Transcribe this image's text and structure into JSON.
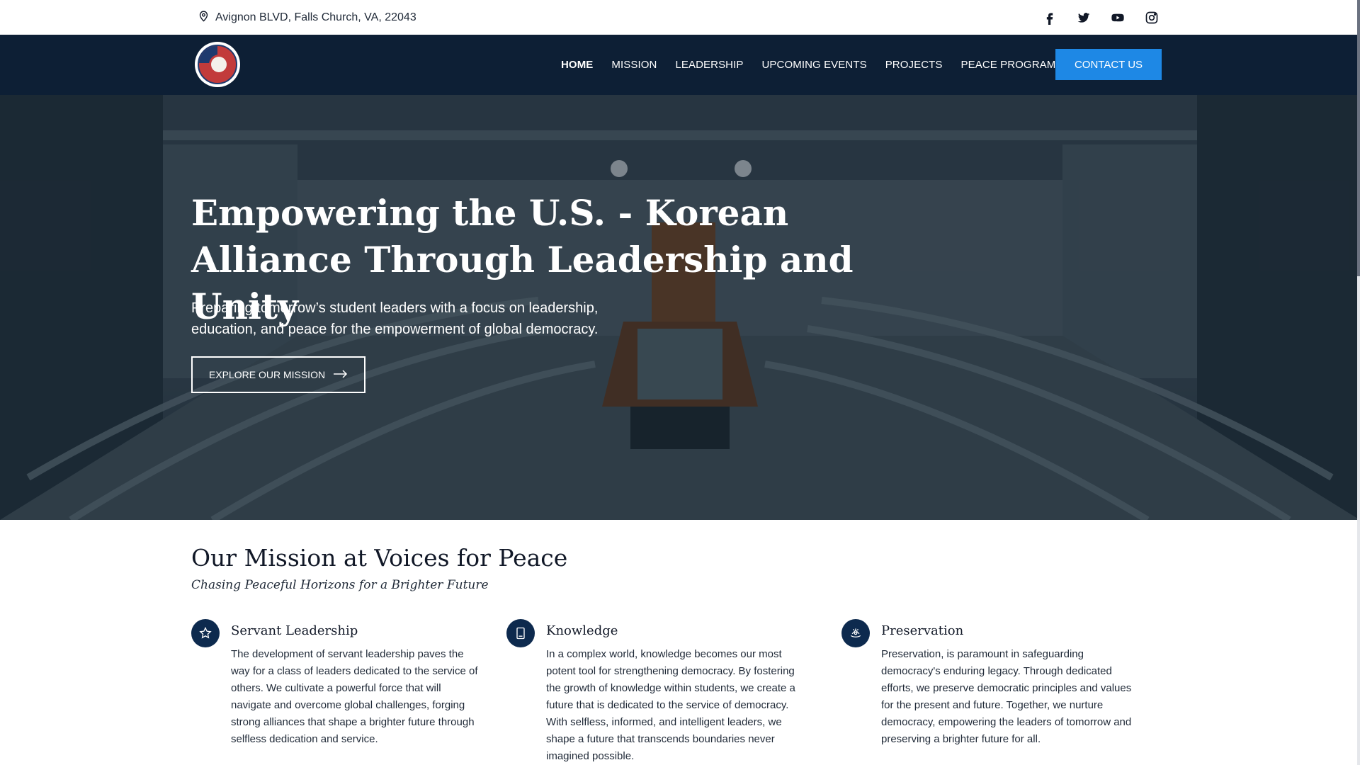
{
  "topbar": {
    "address": "Avignon BLVD, Falls Church, VA, 22043",
    "socials": [
      {
        "icon": "facebook-icon"
      },
      {
        "icon": "twitter-icon"
      },
      {
        "icon": "youtube-icon"
      },
      {
        "icon": "instagram-icon"
      }
    ]
  },
  "nav": {
    "items": [
      {
        "label": "HOME",
        "active": true
      },
      {
        "label": "MISSION"
      },
      {
        "label": "LEADERSHIP"
      },
      {
        "label": "UPCOMING EVENTS"
      },
      {
        "label": "PROJECTS"
      },
      {
        "label": "PEACE PROGRAM"
      }
    ],
    "contact_label": "CONTACT US"
  },
  "hero": {
    "title": "Empowering the U.S. - Korean Alliance Through Leadership and Unity",
    "subtitle": "Preparing tomorrow’s student leaders with a focus on leadership, education, and peace for the empowerment of global democracy.",
    "button_label": "EXPLORE OUR MISSION"
  },
  "mission": {
    "title": "Our Mission at Voices for Peace",
    "subtitle": "Chasing Peaceful Horizons for a Brighter Future",
    "pillars": [
      {
        "icon": "star-icon",
        "title": "Servant Leadership",
        "body": "The development of servant leadership paves the way for a class of leaders dedicated to the service of others. We cultivate a powerful force that will navigate and overcome global challenges, forging strong alliances that shape a brighter future through selfless dedication and service."
      },
      {
        "icon": "tablet-icon",
        "title": "Knowledge",
        "body": "In a complex world, knowledge becomes our most potent tool for strengthening democracy. By fostering the growth of knowledge within students, we create a future that is dedicated to the service of democracy. With selfless, informed, and intelligent leaders, we shape a future that transcends boundaries never imagined possible."
      },
      {
        "icon": "preservation-icon",
        "title": "Preservation",
        "body": "Preservation, is paramount in safeguarding democracy's enduring legacy. Through dedicated efforts, we preserve democratic principles and values for the present and future. Together, we nurture democracy, empowering the leaders of tomorrow and preserving a brighter future for all."
      }
    ]
  },
  "colors": {
    "nav_bg": "#0d1f35",
    "accent": "#1e88e5",
    "icon_bg": "#0d2a4e"
  }
}
